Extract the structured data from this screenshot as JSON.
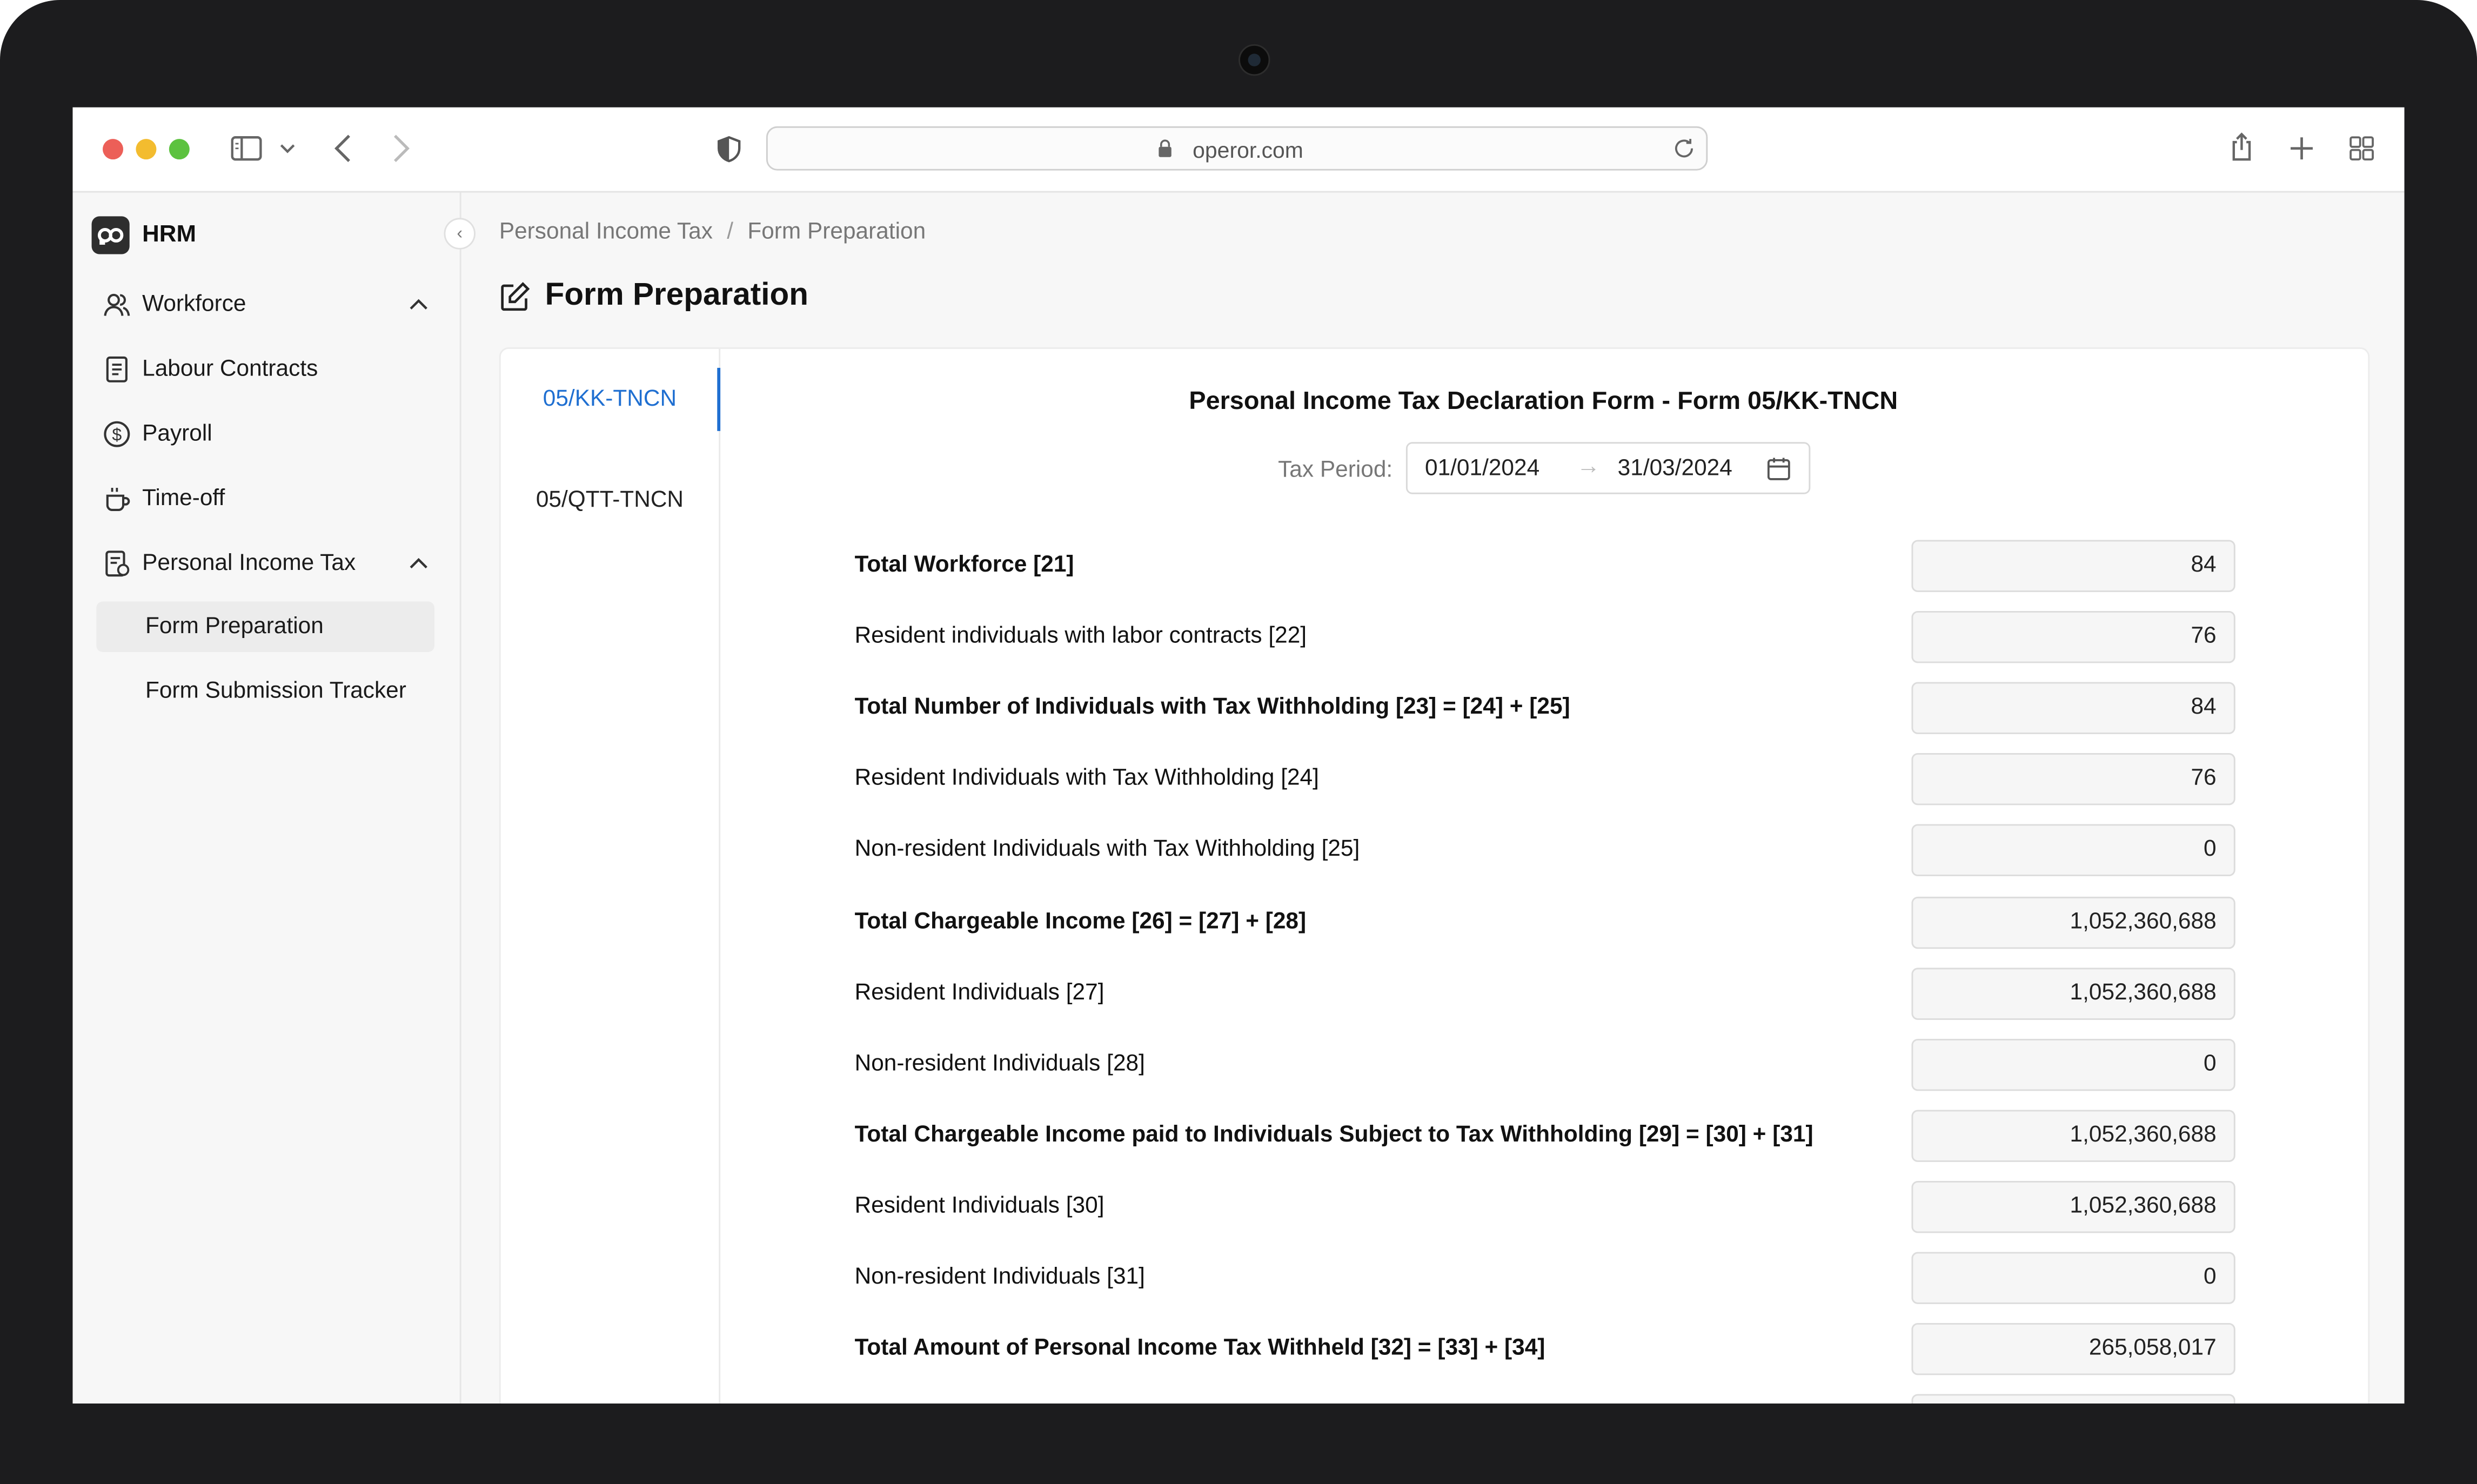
{
  "browser": {
    "url": "operor.com"
  },
  "app": {
    "brand": "HRM",
    "nav": {
      "workforce": "Workforce",
      "labour_contracts": "Labour Contracts",
      "payroll": "Payroll",
      "time_off": "Time-off",
      "personal_income_tax": "Personal Income Tax",
      "sub_items": [
        "Form Preparation",
        "Form Submission Tracker"
      ]
    }
  },
  "breadcrumb": [
    "Personal Income Tax",
    "Form Preparation"
  ],
  "page_title": "Form Preparation",
  "tabs": [
    {
      "label": "05/KK-TNCN",
      "active": true
    },
    {
      "label": "05/QTT-TNCN",
      "active": false
    }
  ],
  "form": {
    "title": "Personal Income Tax Declaration Form - Form 05/KK-TNCN",
    "tax_period_label": "Tax Period:",
    "start_date": "01/01/2024",
    "end_date": "31/03/2024",
    "rows": [
      {
        "label": "Total Workforce [21]",
        "value": "84",
        "bold": true
      },
      {
        "label": "Resident individuals with labor contracts [22]",
        "value": "76",
        "bold": false
      },
      {
        "label": "Total Number of Individuals with Tax Withholding [23] = [24] + [25]",
        "value": "84",
        "bold": true
      },
      {
        "label": "Resident Individuals with Tax Withholding [24]",
        "value": "76",
        "bold": false
      },
      {
        "label": "Non-resident Individuals with Tax Withholding [25]",
        "value": "0",
        "bold": false
      },
      {
        "label": "Total Chargeable Income [26] = [27] + [28]",
        "value": "1,052,360,688",
        "bold": true
      },
      {
        "label": "Resident Individuals [27]",
        "value": "1,052,360,688",
        "bold": false
      },
      {
        "label": "Non-resident Individuals [28]",
        "value": "0",
        "bold": false
      },
      {
        "label": "Total Chargeable Income paid to Individuals Subject to Tax Withholding [29] = [30] + [31]",
        "value": "1,052,360,688",
        "bold": true
      },
      {
        "label": "Resident Individuals [30]",
        "value": "1,052,360,688",
        "bold": false
      },
      {
        "label": "Non-resident Individuals [31]",
        "value": "0",
        "bold": false
      },
      {
        "label": "Total Amount of Personal Income Tax Withheld [32] = [33] + [34]",
        "value": "265,058,017",
        "bold": true
      }
    ]
  }
}
